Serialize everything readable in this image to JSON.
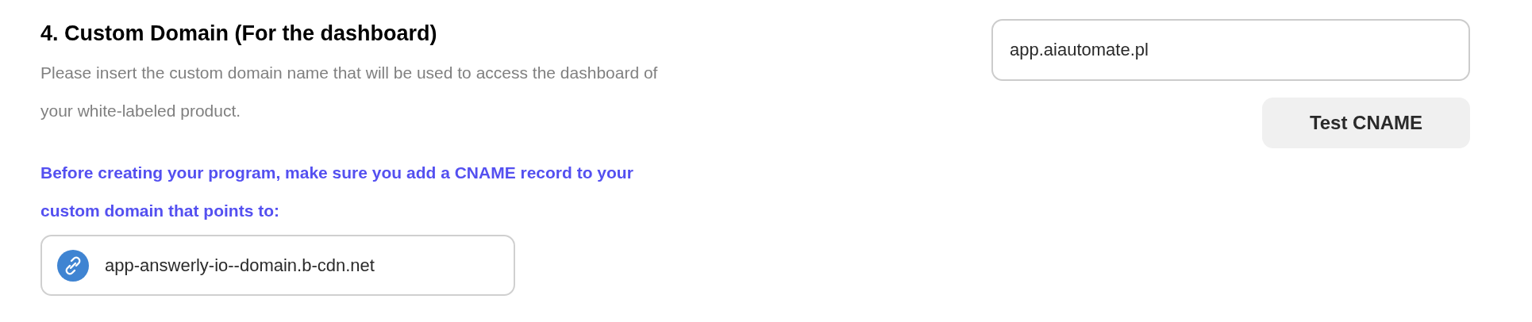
{
  "section": {
    "title": "4. Custom Domain (For the dashboard)",
    "description": "Please insert the custom domain name that will be used to access the dashboard of your white-labeled product.",
    "notice": "Before creating your program, make sure you add a CNAME record to your custom domain that points to:",
    "cname_target": "app-answerly-io--domain.b-cdn.net",
    "domain_field": {
      "value": "app.aiautomate.pl"
    },
    "test_button": "Test CNAME"
  }
}
